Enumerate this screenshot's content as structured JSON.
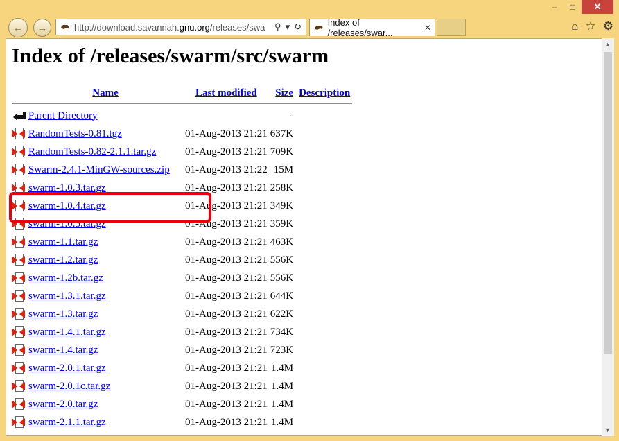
{
  "browser": {
    "address_domain_prefix": "http://download.savannah.",
    "address_domain_bold": "gnu.org",
    "address_path": "/releases/swa",
    "tab_title": "Index of /releases/swar...",
    "window_buttons": [
      "–",
      "□",
      "✕"
    ],
    "toolbar_icons": [
      "home-icon",
      "star-icon",
      "gear-icon"
    ]
  },
  "page": {
    "title": "Index of /releases/swarm/src/swarm",
    "columns": [
      "Name",
      "Last modified",
      "Size",
      "Description"
    ],
    "rows": [
      {
        "name": "Parent Directory",
        "date": "",
        "size": "-",
        "type": "back"
      },
      {
        "name": "RandomTests-0.81.tgz",
        "date": "01-Aug-2013 21:21",
        "size": "637K",
        "type": "file"
      },
      {
        "name": "RandomTests-0.82-2.1.1.tar.gz",
        "date": "01-Aug-2013 21:21",
        "size": "709K",
        "type": "file"
      },
      {
        "name": "Swarm-2.4.1-MinGW-sources.zip",
        "date": "01-Aug-2013 21:22",
        "size": "15M",
        "type": "file"
      },
      {
        "name": "swarm-1.0.3.tar.gz",
        "date": "01-Aug-2013 21:21",
        "size": "258K",
        "type": "file"
      },
      {
        "name": "swarm-1.0.4.tar.gz",
        "date": "01-Aug-2013 21:21",
        "size": "349K",
        "type": "file"
      },
      {
        "name": "swarm-1.0.5.tar.gz",
        "date": "01-Aug-2013 21:21",
        "size": "359K",
        "type": "file"
      },
      {
        "name": "swarm-1.1.tar.gz",
        "date": "01-Aug-2013 21:21",
        "size": "463K",
        "type": "file"
      },
      {
        "name": "swarm-1.2.tar.gz",
        "date": "01-Aug-2013 21:21",
        "size": "556K",
        "type": "file"
      },
      {
        "name": "swarm-1.2b.tar.gz",
        "date": "01-Aug-2013 21:21",
        "size": "556K",
        "type": "file"
      },
      {
        "name": "swarm-1.3.1.tar.gz",
        "date": "01-Aug-2013 21:21",
        "size": "644K",
        "type": "file"
      },
      {
        "name": "swarm-1.3.tar.gz",
        "date": "01-Aug-2013 21:21",
        "size": "622K",
        "type": "file"
      },
      {
        "name": "swarm-1.4.1.tar.gz",
        "date": "01-Aug-2013 21:21",
        "size": "734K",
        "type": "file"
      },
      {
        "name": "swarm-1.4.tar.gz",
        "date": "01-Aug-2013 21:21",
        "size": "723K",
        "type": "file"
      },
      {
        "name": "swarm-2.0.1.tar.gz",
        "date": "01-Aug-2013 21:21",
        "size": "1.4M",
        "type": "file"
      },
      {
        "name": "swarm-2.0.1c.tar.gz",
        "date": "01-Aug-2013 21:21",
        "size": "1.4M",
        "type": "file"
      },
      {
        "name": "swarm-2.0.tar.gz",
        "date": "01-Aug-2013 21:21",
        "size": "1.4M",
        "type": "file"
      },
      {
        "name": "swarm-2.1.1.tar.gz",
        "date": "01-Aug-2013 21:21",
        "size": "1.4M",
        "type": "file"
      }
    ]
  },
  "colors": {
    "frame": "#f7d57e",
    "link": "#0000ee",
    "highlight": "#e8000f",
    "close_button": "#c7433c"
  }
}
